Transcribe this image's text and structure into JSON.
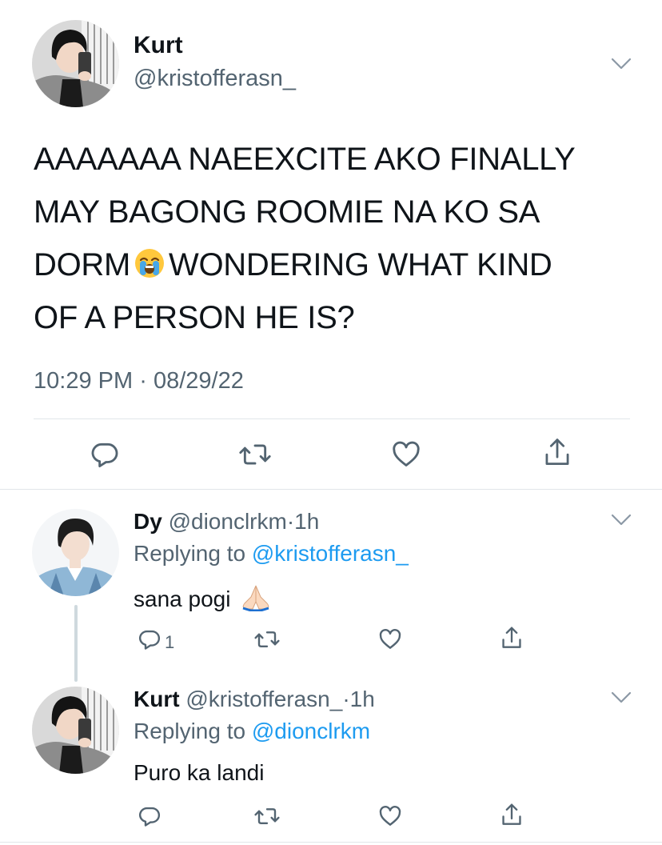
{
  "main_tweet": {
    "author_name": "Kurt",
    "author_handle": "@kristofferasn_",
    "text_lines": [
      "AAAAAAA NAEEXCITE AKO FINALLY",
      "MAY BAGONG ROOMIE NA KO SA",
      "DORM",
      "WONDERING WHAT KIND",
      "OF A PERSON HE IS?"
    ],
    "emoji": "loudly-crying-face",
    "time": "10:29 PM",
    "date_separator": "·",
    "date": "08/29/22",
    "actions": [
      "reply-icon",
      "retweet-icon",
      "like-icon",
      "share-icon"
    ]
  },
  "replies": [
    {
      "author_name": "Dy",
      "author_handle": "@dionclrkm",
      "separator": "·",
      "time": "1h",
      "replying_prefix": "Replying to",
      "replying_to": "@kristofferasn_",
      "text": "sana pogi",
      "emoji": "folded-hands",
      "reply_count": "1"
    },
    {
      "author_name": "Kurt",
      "author_handle": "@kristofferasn_",
      "separator": "·",
      "time": "1h",
      "replying_prefix": "Replying to",
      "replying_to": "@dionclrkm",
      "text": "Puro ka landi",
      "reply_count": ""
    }
  ],
  "colors": {
    "text": "#0f1419",
    "secondary": "#536471",
    "link": "#1d9bf0",
    "divider": "#e1e6ea"
  }
}
